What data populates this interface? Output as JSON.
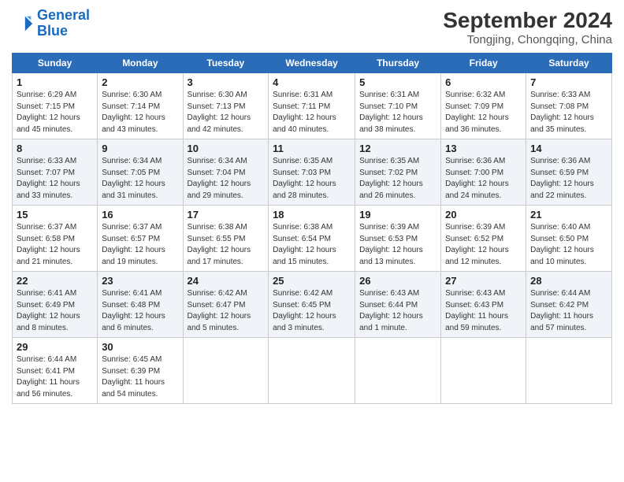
{
  "header": {
    "logo_line1": "General",
    "logo_line2": "Blue",
    "main_title": "September 2024",
    "subtitle": "Tongjing, Chongqing, China"
  },
  "days_of_week": [
    "Sunday",
    "Monday",
    "Tuesday",
    "Wednesday",
    "Thursday",
    "Friday",
    "Saturday"
  ],
  "weeks": [
    [
      {
        "day": "1",
        "info": "Sunrise: 6:29 AM\nSunset: 7:15 PM\nDaylight: 12 hours\nand 45 minutes."
      },
      {
        "day": "2",
        "info": "Sunrise: 6:30 AM\nSunset: 7:14 PM\nDaylight: 12 hours\nand 43 minutes."
      },
      {
        "day": "3",
        "info": "Sunrise: 6:30 AM\nSunset: 7:13 PM\nDaylight: 12 hours\nand 42 minutes."
      },
      {
        "day": "4",
        "info": "Sunrise: 6:31 AM\nSunset: 7:11 PM\nDaylight: 12 hours\nand 40 minutes."
      },
      {
        "day": "5",
        "info": "Sunrise: 6:31 AM\nSunset: 7:10 PM\nDaylight: 12 hours\nand 38 minutes."
      },
      {
        "day": "6",
        "info": "Sunrise: 6:32 AM\nSunset: 7:09 PM\nDaylight: 12 hours\nand 36 minutes."
      },
      {
        "day": "7",
        "info": "Sunrise: 6:33 AM\nSunset: 7:08 PM\nDaylight: 12 hours\nand 35 minutes."
      }
    ],
    [
      {
        "day": "8",
        "info": "Sunrise: 6:33 AM\nSunset: 7:07 PM\nDaylight: 12 hours\nand 33 minutes."
      },
      {
        "day": "9",
        "info": "Sunrise: 6:34 AM\nSunset: 7:05 PM\nDaylight: 12 hours\nand 31 minutes."
      },
      {
        "day": "10",
        "info": "Sunrise: 6:34 AM\nSunset: 7:04 PM\nDaylight: 12 hours\nand 29 minutes."
      },
      {
        "day": "11",
        "info": "Sunrise: 6:35 AM\nSunset: 7:03 PM\nDaylight: 12 hours\nand 28 minutes."
      },
      {
        "day": "12",
        "info": "Sunrise: 6:35 AM\nSunset: 7:02 PM\nDaylight: 12 hours\nand 26 minutes."
      },
      {
        "day": "13",
        "info": "Sunrise: 6:36 AM\nSunset: 7:00 PM\nDaylight: 12 hours\nand 24 minutes."
      },
      {
        "day": "14",
        "info": "Sunrise: 6:36 AM\nSunset: 6:59 PM\nDaylight: 12 hours\nand 22 minutes."
      }
    ],
    [
      {
        "day": "15",
        "info": "Sunrise: 6:37 AM\nSunset: 6:58 PM\nDaylight: 12 hours\nand 21 minutes."
      },
      {
        "day": "16",
        "info": "Sunrise: 6:37 AM\nSunset: 6:57 PM\nDaylight: 12 hours\nand 19 minutes."
      },
      {
        "day": "17",
        "info": "Sunrise: 6:38 AM\nSunset: 6:55 PM\nDaylight: 12 hours\nand 17 minutes."
      },
      {
        "day": "18",
        "info": "Sunrise: 6:38 AM\nSunset: 6:54 PM\nDaylight: 12 hours\nand 15 minutes."
      },
      {
        "day": "19",
        "info": "Sunrise: 6:39 AM\nSunset: 6:53 PM\nDaylight: 12 hours\nand 13 minutes."
      },
      {
        "day": "20",
        "info": "Sunrise: 6:39 AM\nSunset: 6:52 PM\nDaylight: 12 hours\nand 12 minutes."
      },
      {
        "day": "21",
        "info": "Sunrise: 6:40 AM\nSunset: 6:50 PM\nDaylight: 12 hours\nand 10 minutes."
      }
    ],
    [
      {
        "day": "22",
        "info": "Sunrise: 6:41 AM\nSunset: 6:49 PM\nDaylight: 12 hours\nand 8 minutes."
      },
      {
        "day": "23",
        "info": "Sunrise: 6:41 AM\nSunset: 6:48 PM\nDaylight: 12 hours\nand 6 minutes."
      },
      {
        "day": "24",
        "info": "Sunrise: 6:42 AM\nSunset: 6:47 PM\nDaylight: 12 hours\nand 5 minutes."
      },
      {
        "day": "25",
        "info": "Sunrise: 6:42 AM\nSunset: 6:45 PM\nDaylight: 12 hours\nand 3 minutes."
      },
      {
        "day": "26",
        "info": "Sunrise: 6:43 AM\nSunset: 6:44 PM\nDaylight: 12 hours\nand 1 minute."
      },
      {
        "day": "27",
        "info": "Sunrise: 6:43 AM\nSunset: 6:43 PM\nDaylight: 11 hours\nand 59 minutes."
      },
      {
        "day": "28",
        "info": "Sunrise: 6:44 AM\nSunset: 6:42 PM\nDaylight: 11 hours\nand 57 minutes."
      }
    ],
    [
      {
        "day": "29",
        "info": "Sunrise: 6:44 AM\nSunset: 6:41 PM\nDaylight: 11 hours\nand 56 minutes."
      },
      {
        "day": "30",
        "info": "Sunrise: 6:45 AM\nSunset: 6:39 PM\nDaylight: 11 hours\nand 54 minutes."
      },
      {
        "day": "",
        "info": ""
      },
      {
        "day": "",
        "info": ""
      },
      {
        "day": "",
        "info": ""
      },
      {
        "day": "",
        "info": ""
      },
      {
        "day": "",
        "info": ""
      }
    ]
  ]
}
